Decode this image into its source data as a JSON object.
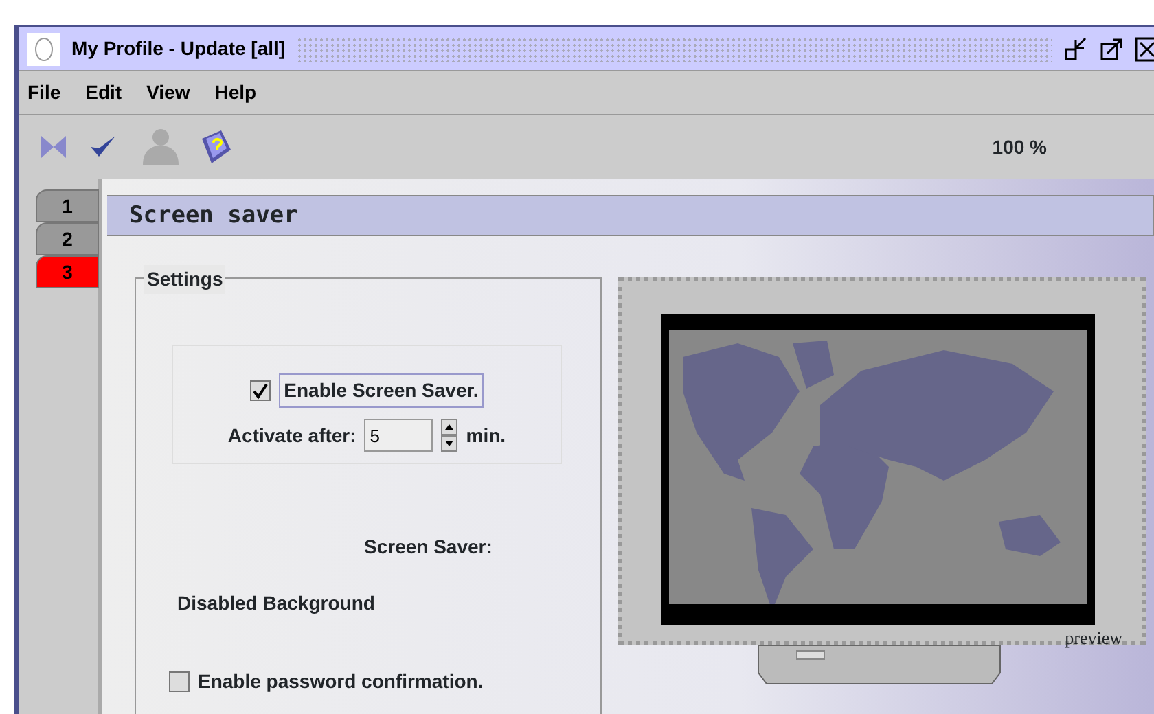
{
  "window": {
    "title": "My Profile - Update [all]"
  },
  "menu": [
    "File",
    "Edit",
    "View",
    "Help"
  ],
  "toolbar": {
    "zoom": "100 %"
  },
  "tabs": [
    {
      "label": "1",
      "selected": false
    },
    {
      "label": "2",
      "selected": false
    },
    {
      "label": "3",
      "selected": true
    }
  ],
  "section_title": "Screen saver",
  "settings": {
    "legend": "Settings",
    "enable_saver": {
      "label": "Enable Screen Saver.",
      "checked": true
    },
    "activate": {
      "label": "Activate after:",
      "value": "5",
      "unit": "min."
    },
    "saver_label": "Screen Saver:",
    "saver_value": "Disabled Background",
    "password": {
      "label": "Enable password confirmation.",
      "checked": false
    }
  },
  "preview": {
    "caption": "preview"
  }
}
